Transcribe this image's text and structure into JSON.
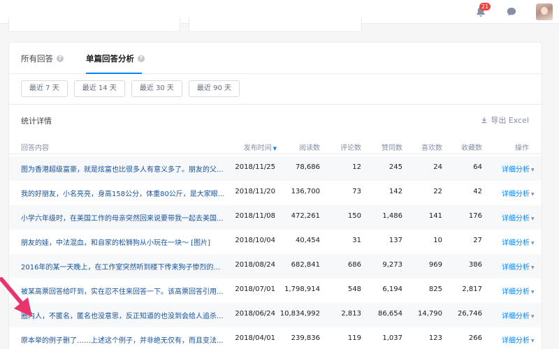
{
  "header": {
    "notification_count": "21",
    "icons": [
      "bell-icon",
      "chat-bubble-icon",
      "avatar"
    ]
  },
  "tabs": [
    {
      "label": "所有回答",
      "active": false
    },
    {
      "label": "单篇回答分析",
      "active": true
    }
  ],
  "ranges": [
    "最近 7 天",
    "最近 14 天",
    "最近 30 天",
    "最近 90 天"
  ],
  "section_title": "统计详情",
  "export_label": "导出 Excel",
  "columns": {
    "content": "回答内容",
    "date": "发布时间",
    "reads": "阅读数",
    "comments": "评论数",
    "likes": "赞同数",
    "favs": "喜欢数",
    "collects": "收藏数",
    "action": "操作"
  },
  "rows": [
    {
      "title": "图为香港超级富豪，就是炫富也比很多人有意义多了。朋友的父...",
      "date": "2018/11/25",
      "reads": "78,686",
      "comments": "12",
      "likes": "245",
      "favs": "24",
      "collects": "64",
      "action": "详细分析"
    },
    {
      "title": "我的好朋友，小名亮亮，身高158公分，体重80公斤，是大家眼...",
      "date": "2018/11/20",
      "reads": "136,700",
      "comments": "73",
      "likes": "142",
      "favs": "22",
      "collects": "42",
      "action": "详细分析"
    },
    {
      "title": "小学六年级时，在美国工作的母亲突然回来说要带我一起去美国...",
      "date": "2018/11/08",
      "reads": "472,261",
      "comments": "150",
      "likes": "1,486",
      "favs": "141",
      "collects": "176",
      "action": "详细分析"
    },
    {
      "title": "朋友的娃，中法混血，和自家的松狮狗从小玩在一块～ [图片]",
      "date": "2018/10/04",
      "reads": "40,454",
      "comments": "31",
      "likes": "137",
      "favs": "10",
      "collects": "27",
      "action": "详细分析"
    },
    {
      "title": "2016年的某一天晚上，在工作室突然听到楼下传来狗子惨烈的哭...",
      "date": "2018/08/24",
      "reads": "682,841",
      "comments": "686",
      "likes": "9,273",
      "favs": "969",
      "collects": "386",
      "action": "详细分析"
    },
    {
      "title": "被某高票回答给吓到，实在忍不住来回答一下。该高票回答引用...",
      "date": "2018/07/01",
      "reads": "1,798,914",
      "comments": "548",
      "likes": "6,194",
      "favs": "825",
      "collects": "2,817",
      "action": "详细分析"
    },
    {
      "title": "圈内人，不匿名，匿名也没意思，反正知道的也没到会给人追杀...",
      "date": "2018/06/24",
      "reads": "10,834,992",
      "comments": "2,813",
      "likes": "86,654",
      "favs": "14,790",
      "collects": "26,746",
      "action": "详细分析"
    },
    {
      "title": "原本举的例子删了……上述这个例子，并非绝无仅有，而且变法...",
      "date": "2018/04/01",
      "reads": "239,836",
      "comments": "119",
      "likes": "1,037",
      "favs": "123",
      "collects": "266",
      "action": "详细分析"
    }
  ],
  "colors": {
    "accent": "#0084ff",
    "title_link": "#175199",
    "arrow": "#e8336d",
    "badge": "#f1403c"
  }
}
